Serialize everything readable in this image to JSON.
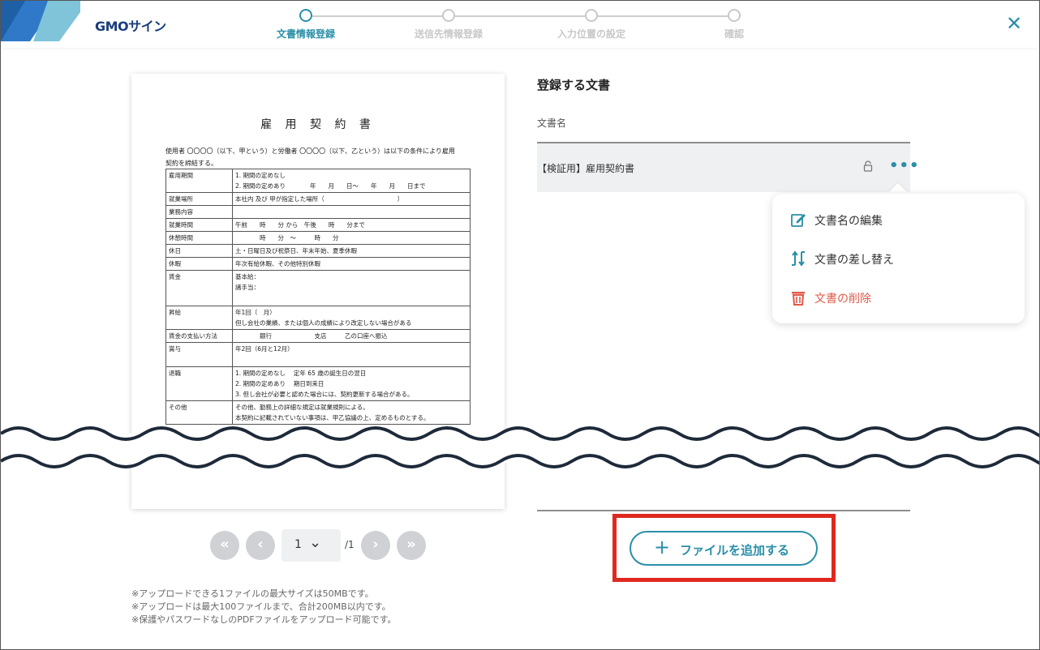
{
  "brand": {
    "name": "GMOサイン"
  },
  "steps": [
    {
      "label": "文書情報登録",
      "active": true
    },
    {
      "label": "送信先情報登録",
      "active": false
    },
    {
      "label": "入力位置の設定",
      "active": false
    },
    {
      "label": "確認",
      "active": false
    }
  ],
  "document_preview": {
    "title": "雇 用 契 約 書",
    "intro_line1": "使用者 〇〇〇〇（以下、甲という）と労働者 〇〇〇〇（以下、乙という）は以下の条件により雇用",
    "intro_line2": "契約を締結する。",
    "rows": [
      {
        "head": "雇用期間",
        "body1": "1. 期間の定めなし",
        "body2": "2. 期間の定めあり　　　　年　　月　　日～　　年　　月　　日まで"
      },
      {
        "head": "就業場所",
        "body1": "本社内 及び 甲が指定した場所（　　　　　　　　　　　　）"
      },
      {
        "head": "業務内容",
        "body1": ""
      },
      {
        "head": "就業時間",
        "body1": "午前　　時　　分 から　午後　　時　　分まで"
      },
      {
        "head": "休憩時間",
        "body1": "　　　　時　　分　～　　　時　　分"
      },
      {
        "head": "休日",
        "body1": "土・日曜日及び祝祭日、年末年始、夏季休暇"
      },
      {
        "head": "休暇",
        "body1": "年次有給休暇、その他特別休暇"
      },
      {
        "head": "賃金",
        "body1": "基本給：",
        "body2": "諸手当："
      },
      {
        "head": "昇給",
        "body1": "年1回（　月）",
        "body2": "但し会社の業績、または個人の成績により改定しない場合がある"
      },
      {
        "head": "賃金の支払い方法",
        "body1": "　　　　銀行　　　　　　　支店　　　乙の口座へ振込"
      },
      {
        "head": "賞与",
        "body1": "年2回（6月と12月）"
      },
      {
        "head": "退職",
        "body1": "1. 期間の定めなし　 定年 65 歳の誕生日の翌日",
        "body2": "2. 期間の定めあり　 期日到来日",
        "body3": "3. 但し会社が必要と認めた場合には、契約更新する場合がある。"
      },
      {
        "head": "その他",
        "body1": "その他、勤務上の詳細な規定は就業規則による。",
        "body2": "本契約に記載されていない事項は、甲乙協議の上、定めるものとする。"
      }
    ]
  },
  "pager": {
    "first": "«",
    "prev": "‹",
    "current": "1",
    "chevron": "⌄",
    "total": "/1",
    "next": "›",
    "last": "»"
  },
  "notes": [
    "※アップロードできる1ファイルの最大サイズは50MBです。",
    "※アップロードは最大100ファイルまで、合計200MB以内です。",
    "※保護やパスワードなしのPDFファイルをアップロード可能です。"
  ],
  "panel": {
    "title": "登録する文書",
    "column_label": "文書名",
    "file_name": "【検証用】雇用契約書",
    "more": "•••"
  },
  "menu": {
    "items": [
      {
        "label": "文書名の編集",
        "icon": "edit-icon"
      },
      {
        "label": "文書の差し替え",
        "icon": "swap-icon"
      },
      {
        "label": "文書の削除",
        "icon": "trash-icon"
      }
    ]
  },
  "add_button": {
    "plus": "+",
    "label": "ファイルを追加する"
  },
  "close": {
    "symbol": "✕"
  },
  "colors": {
    "accent": "#2a8fa8",
    "danger": "#e05a4a",
    "highlight": "#e0281f",
    "brand_navy": "#1a3d7c"
  }
}
